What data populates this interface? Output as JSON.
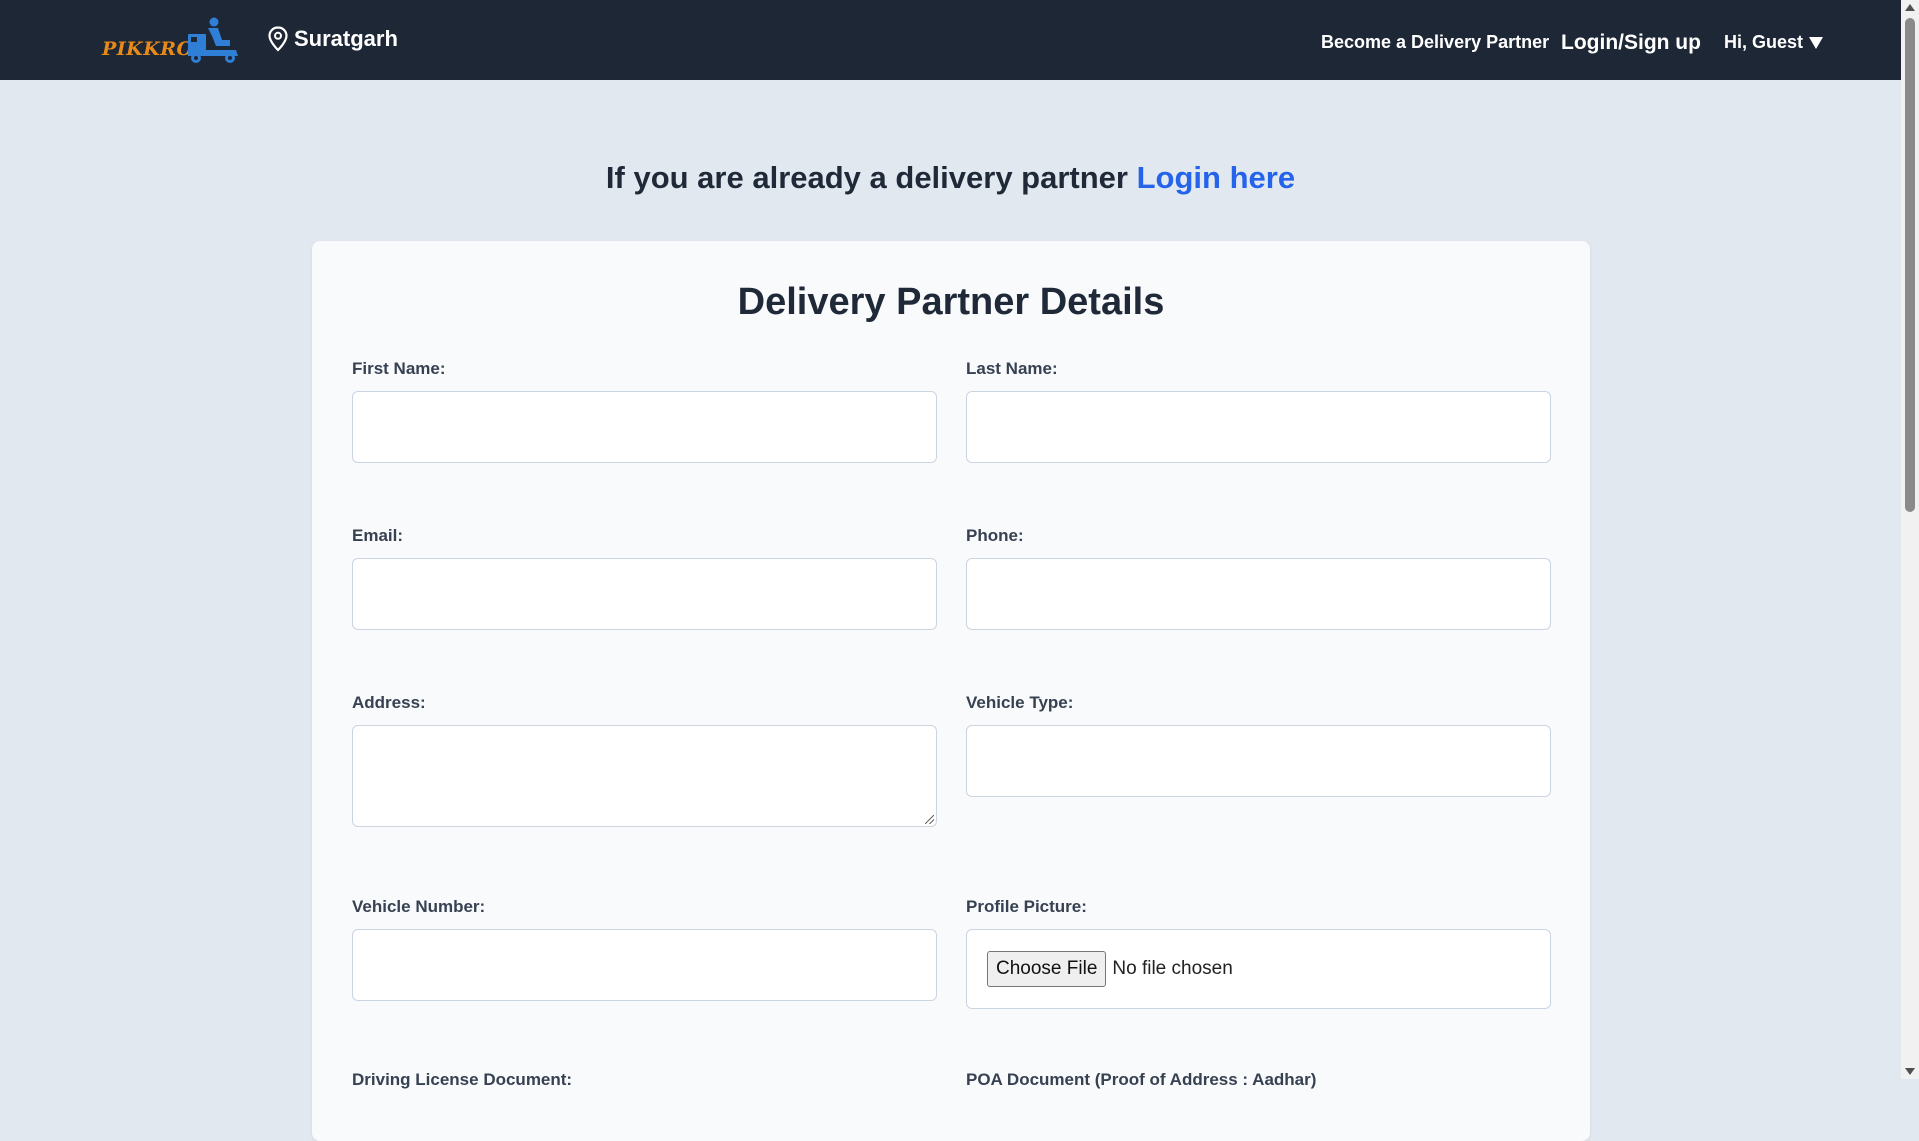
{
  "header": {
    "logo_text": "PIKKRO",
    "location": "Suratgarh",
    "nav": {
      "become_partner": "Become a Delivery Partner",
      "login_signup": "Login/Sign up",
      "guest": "Hi, Guest"
    }
  },
  "banner": {
    "prefix": "If you are already a delivery partner",
    "link": "Login here"
  },
  "form": {
    "title": "Delivery Partner Details",
    "fields": {
      "first_name": "First Name:",
      "last_name": "Last Name:",
      "email": "Email:",
      "phone": "Phone:",
      "address": "Address:",
      "vehicle_type": "Vehicle Type:",
      "vehicle_number": "Vehicle Number:",
      "profile_picture": "Profile Picture:",
      "driving_license": "Driving License Document:",
      "poa_document": "POA Document (Proof of Address : Aadhar)"
    },
    "file_input": {
      "button": "Choose File",
      "status": "No file chosen"
    }
  },
  "colors": {
    "header_bg": "#1e2736",
    "page_bg": "#e2e8f0",
    "link": "#2563eb",
    "logo_orange": "#e88a18",
    "logo_blue": "#2f7fd6"
  }
}
